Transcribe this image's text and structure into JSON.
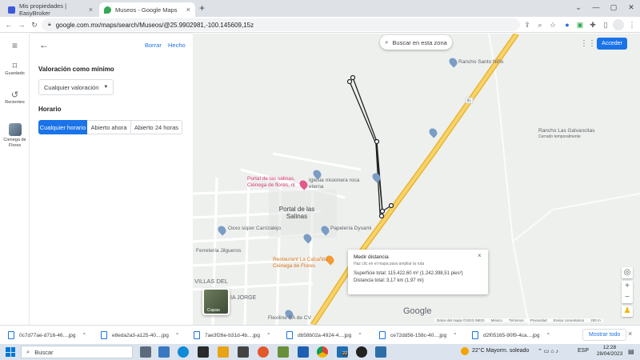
{
  "browser": {
    "tabs": [
      {
        "title": "Mis propiedades | EasyBroker",
        "favicon_color": "#3b5bdb",
        "active": false
      },
      {
        "title": "Museos - Google Maps",
        "favicon_color": "#34a853",
        "active": true
      }
    ],
    "new_tab_label": "+",
    "url": "google.com.mx/maps/search/Museos/@25.9902981,-100.145609,15z"
  },
  "rail": {
    "menu_icon": "menu-icon",
    "items": [
      {
        "label": "Guardado",
        "icon": "bookmark-icon"
      },
      {
        "label": "Recientes",
        "icon": "history-icon"
      },
      {
        "label": "Cienega de Flores",
        "icon": "place-thumbnail"
      }
    ]
  },
  "panel": {
    "back_icon": "arrow-back-icon",
    "clear_label": "Borrar",
    "done_label": "Hecho",
    "rating_heading": "Valoración como mínimo",
    "rating_value": "Cualquier valoración",
    "hours_heading": "Horario",
    "hours_options": [
      "Cualquier horario",
      "Abierto ahora",
      "Abierto 24 horas"
    ],
    "hours_selected": 0
  },
  "map": {
    "search_zone_label": "Buscar en esta zona",
    "signin_label": "Acceder",
    "labels": {
      "rancho_santo_nino": "Rancho Santo Niño",
      "rancho_galvancitas": "Rancho Las Galvancitas",
      "rancho_sub": "Cerrado temporalmente",
      "portal_salinas_poi": "Portal de las salinas, Ciénega de flores, nl",
      "iglesia": "Iglesia misionera roca eterna",
      "portal_salinas": "Portal de las Salinas",
      "oxxo": "Oxxo súper Carrizalejo",
      "papeleria": "Papelería Dysami",
      "ferreteria": "Ferretería Jilgueros",
      "restaurant": "Restaurant La Cabañita Ciénega de Flores",
      "villas": "VILLAS DEL",
      "jorge": "IA JORGE",
      "flexiline": "Flexiline SA de CV",
      "layers": "Capas",
      "road": "85"
    },
    "measure": {
      "title": "Medir distancia",
      "hint": "Haz clic en el mapa para ampliar la ruta",
      "area": "Superficie total: 115.422,60 m² (1.242.398,51 pies²)",
      "distance": "Distancia total: 3,17 km (1,97 mi)"
    },
    "attribution": [
      "Datos del mapa ©2023 INEGI",
      "México",
      "Términos",
      "Privacidad",
      "Enviar comentarios",
      "200 m"
    ],
    "google_logo": "Google"
  },
  "downloads": {
    "items": [
      "0c7d77ae-d716-46....jpg",
      "e8eda2a3-a125-40....jpg",
      "7ae3f26e-b31d-4b....jpg",
      "db58b02a-4924-4....jpg",
      "ce72dd56-158c-40....jpg",
      "d2f05165-90f9-4ca....jpg"
    ],
    "show_all_label": "Mostrar todo"
  },
  "taskbar": {
    "search_label": "Buscar",
    "weather": "22°C  Mayorm. soleado",
    "lang": "ESP",
    "time": "12:28",
    "date": "28/04/2023",
    "badge": "22"
  },
  "colors": {
    "accent": "#1a73e8",
    "highway": "#f6c54a",
    "route": "#202124"
  }
}
